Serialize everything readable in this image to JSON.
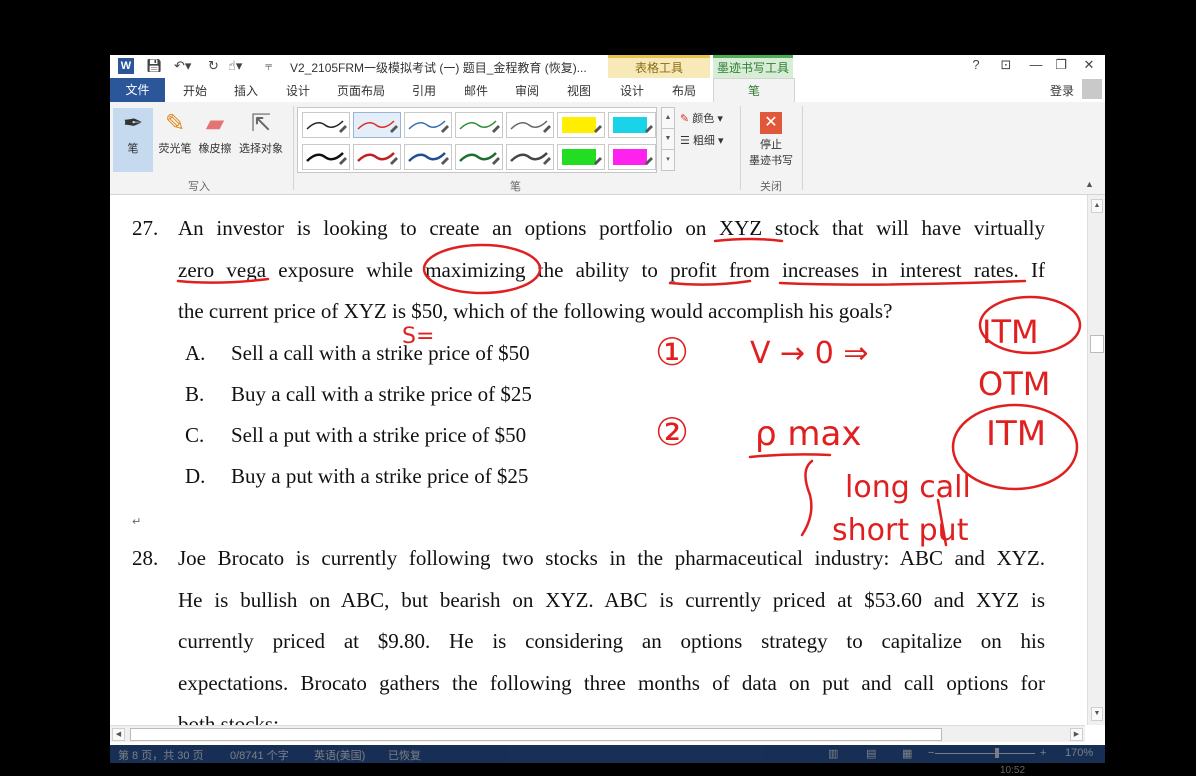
{
  "titlebar": {
    "doc_title": "V2_2105FRM一级模拟考试 (一) 题目_金程教育 (恢复)...",
    "context_table": "表格工具",
    "context_ink": "墨迹书写工具",
    "help": "?",
    "restore_ribbon": "⊡",
    "minimize": "—",
    "maximize": "❐",
    "close": "✕"
  },
  "tabs": {
    "file": "文件",
    "items": [
      "开始",
      "插入",
      "设计",
      "页面布局",
      "引用",
      "邮件",
      "审阅",
      "视图",
      "设计",
      "布局"
    ],
    "pen": "笔",
    "login": "登录"
  },
  "ribbon": {
    "write_group": {
      "label": "写入",
      "pen": "笔",
      "highlighter": "荧光笔",
      "eraser": "橡皮擦",
      "select": "选择对象"
    },
    "pens_group": {
      "label": "笔",
      "color": "颜色",
      "thickness": "粗细",
      "swatches_row1": [
        "#222222",
        "#d9302c",
        "#3a6fb5",
        "#2f8d3a",
        "#666666",
        "#ffee00",
        "#19d3e8"
      ],
      "swatches_row2": [
        "#111111",
        "#c02020",
        "#1f4e99",
        "#1b6e2c",
        "#444444",
        "#22dd22",
        "#ff22ee"
      ]
    },
    "close_group": {
      "label": "关闭",
      "stop_line1": "停止",
      "stop_line2": "墨迹书写"
    }
  },
  "document": {
    "q27": {
      "number": "27.",
      "line1": "An investor is looking to create an options portfolio on XYZ stock that will have virtually",
      "line2": "zero vega exposure while maximizing the ability to profit from increases in interest rates. If",
      "line3": "the current price of XYZ is $50, which of the following would accomplish his goals?",
      "options": [
        {
          "letter": "A.",
          "text": "Sell a call with a strike price of $50"
        },
        {
          "letter": "B.",
          "text": "Buy a call with a strike price of $25"
        },
        {
          "letter": "C.",
          "text": "Sell a put with a strike price of $50"
        },
        {
          "letter": "D.",
          "text": "Buy a put with a strike price of $25"
        }
      ]
    },
    "q28": {
      "number": "28.",
      "line1": "Joe Brocato is currently following two stocks in the pharmaceutical industry: ABC and XYZ.",
      "line2": "He is bullish on ABC, but bearish on XYZ. ABC is currently priced at $53.60 and XYZ is",
      "line3": "currently priced at $9.80. He is considering an options strategy to capitalize on his",
      "line4": "expectations. Brocato gathers the following three months of data on put and call options for",
      "line5": "both stocks:"
    },
    "ink_notes": {
      "s_eq": "S=",
      "step1": "①",
      "v_to_0": "V → 0 ⇒",
      "itm1": "ITM",
      "otm": "OTM",
      "step2": "②",
      "rho_max": "ρ max",
      "itm2": "ITM",
      "long_call": "long call",
      "short_put": "short put"
    },
    "ink_color": "#e02020"
  },
  "statusbar": {
    "page": "第 8 页，共 30 页",
    "words": "0/8741 个字",
    "lang": "英语(美国)",
    "recovered": "已恢复",
    "zoom": "170%"
  },
  "clock": "10:52"
}
